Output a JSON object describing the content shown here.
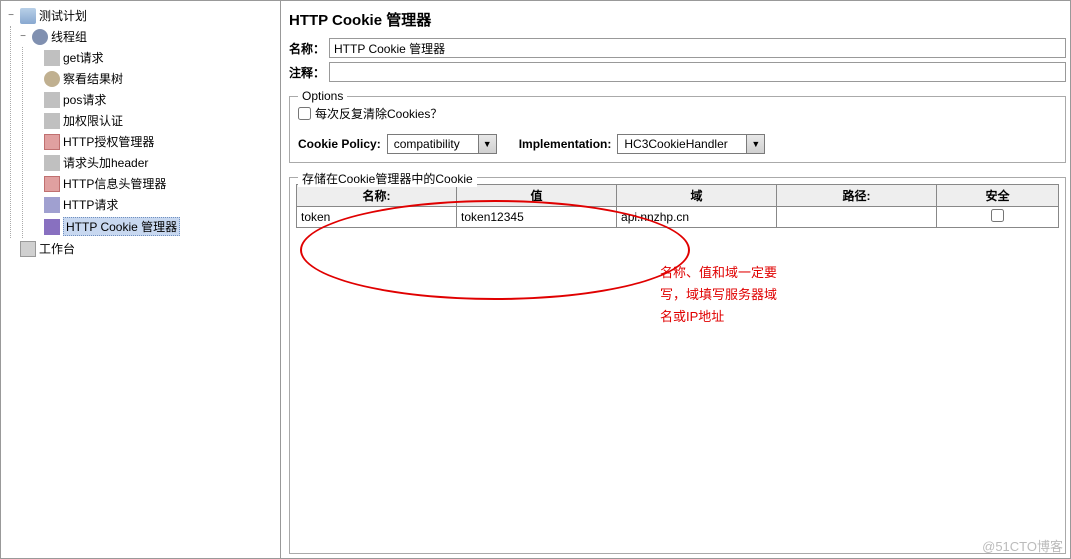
{
  "tree": {
    "root": "测试计划",
    "threadGroup": "线程组",
    "items": [
      "get请求",
      "察看结果树",
      "pos请求",
      "加权限认证",
      "HTTP授权管理器",
      "请求头加header",
      "HTTP信息头管理器",
      "HTTP请求",
      "HTTP Cookie 管理器"
    ],
    "workbench": "工作台"
  },
  "page": {
    "title": "HTTP Cookie 管理器",
    "nameLabel": "名称：",
    "nameValue": "HTTP Cookie 管理器",
    "commentLabel": "注释："
  },
  "options": {
    "legend": "Options",
    "clearEach": "每次反复清除Cookies？",
    "policyLabel": "Cookie Policy:",
    "policyValue": "compatibility",
    "implLabel": "Implementation:",
    "implValue": "HC3CookieHandler"
  },
  "cookies": {
    "legend": "存储在Cookie管理器中的Cookie",
    "headers": [
      "名称:",
      "值",
      "域",
      "路径:",
      "安全"
    ],
    "row": {
      "name": "token",
      "value": "token12345",
      "domain": "api.nnzhp.cn",
      "path": "",
      "secure": false
    }
  },
  "annotation": {
    "l1": "名称、值和域一定要",
    "l2": "写，域填写服务器域",
    "l3": "名或IP地址"
  },
  "watermark": "@51CTO博客"
}
